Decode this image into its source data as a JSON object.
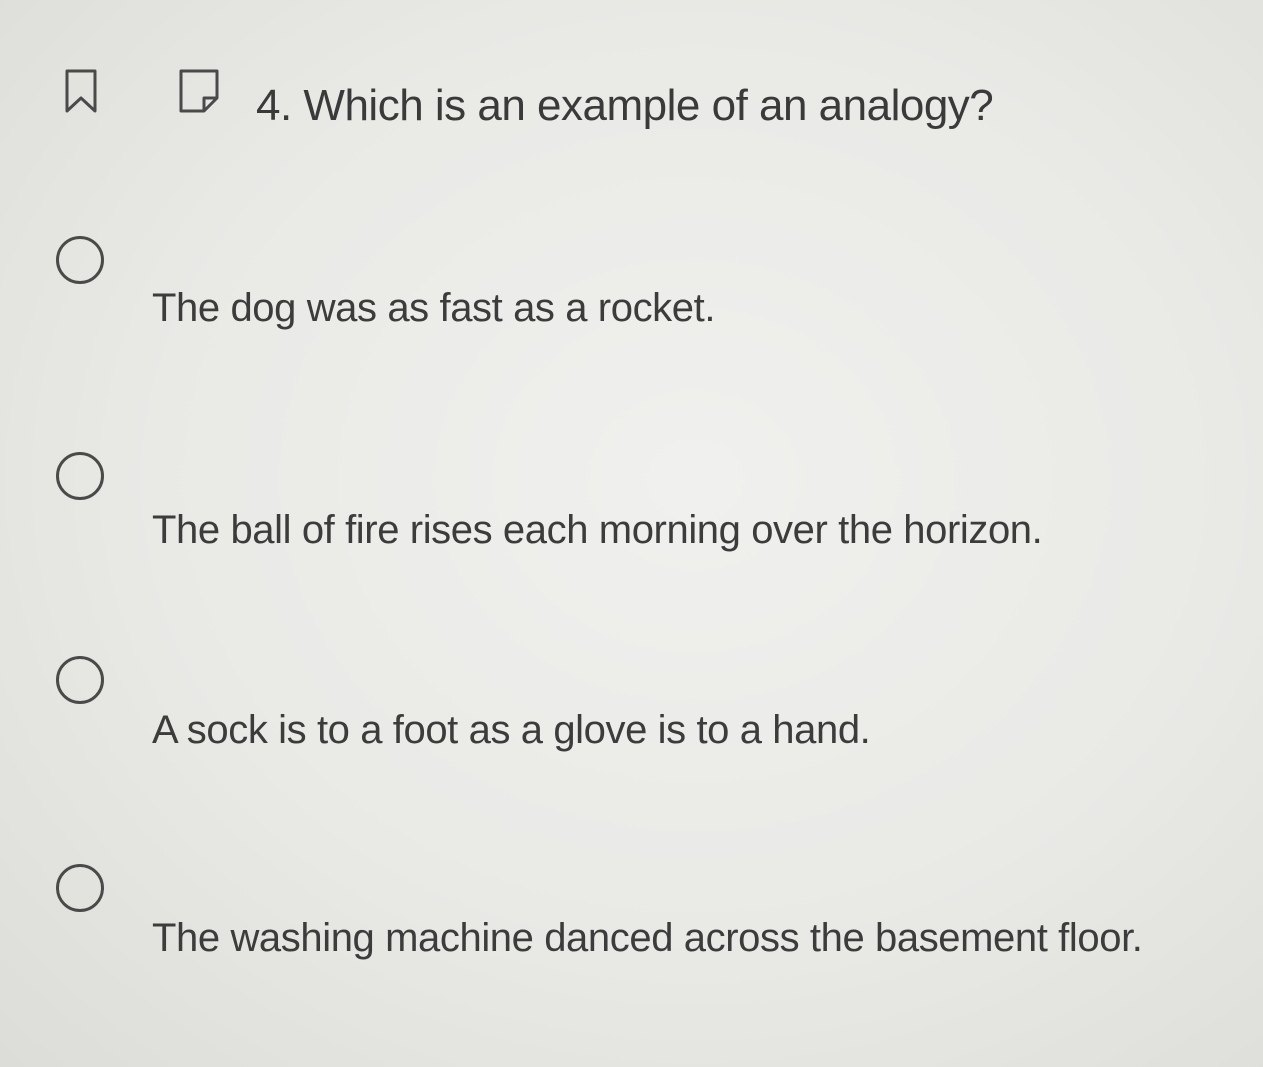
{
  "question": {
    "text": "4. Which is an example of an analogy?",
    "bookmark_icon": "bookmark-icon",
    "note_icon": "note-icon"
  },
  "options": [
    {
      "label": "The dog was as fast as a rocket.",
      "selected": false
    },
    {
      "label": "The ball of fire rises each morning over the horizon.",
      "selected": false
    },
    {
      "label": "A sock is to a foot as a glove is to a hand.",
      "selected": false
    },
    {
      "label": "The washing machine danced across the basement floor.",
      "selected": false
    }
  ],
  "colors": {
    "text": "#3a3a3a",
    "background": "#ececea"
  }
}
